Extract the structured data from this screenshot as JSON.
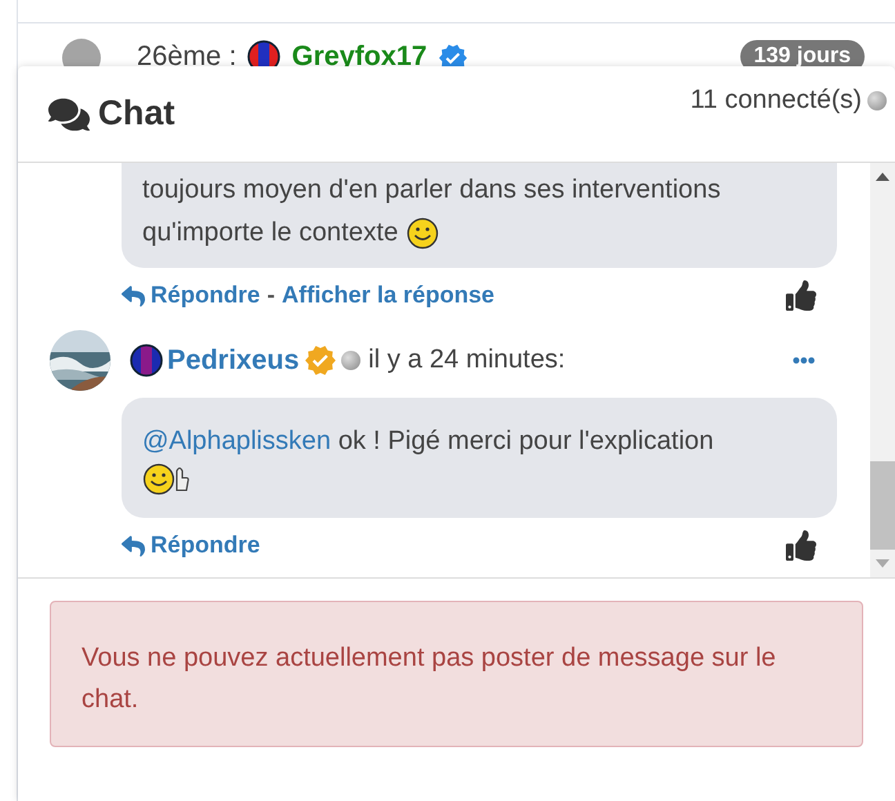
{
  "background_row": {
    "rank": "26ème :",
    "user": "Greyfox17",
    "badge": "139 jours"
  },
  "chat": {
    "title": "Chat",
    "online": "11 connecté(s)",
    "messages": [
      {
        "kind": "partial",
        "text_lines": [
          "toujours moyen d'en parler dans ses interventions",
          "qu'importe le contexte"
        ],
        "actions": [
          "Répondre",
          "Afficher la réponse"
        ],
        "separator": "-"
      },
      {
        "kind": "full",
        "author": "Pedrixeus",
        "time": "il y a 24 minutes:",
        "mention": "@Alphaplissken",
        "text": "ok ! Pigé merci pour l'explication",
        "actions": [
          "Répondre"
        ]
      }
    ]
  },
  "alert": "Vous ne pouvez actuellement pas poster de message sur le chat."
}
